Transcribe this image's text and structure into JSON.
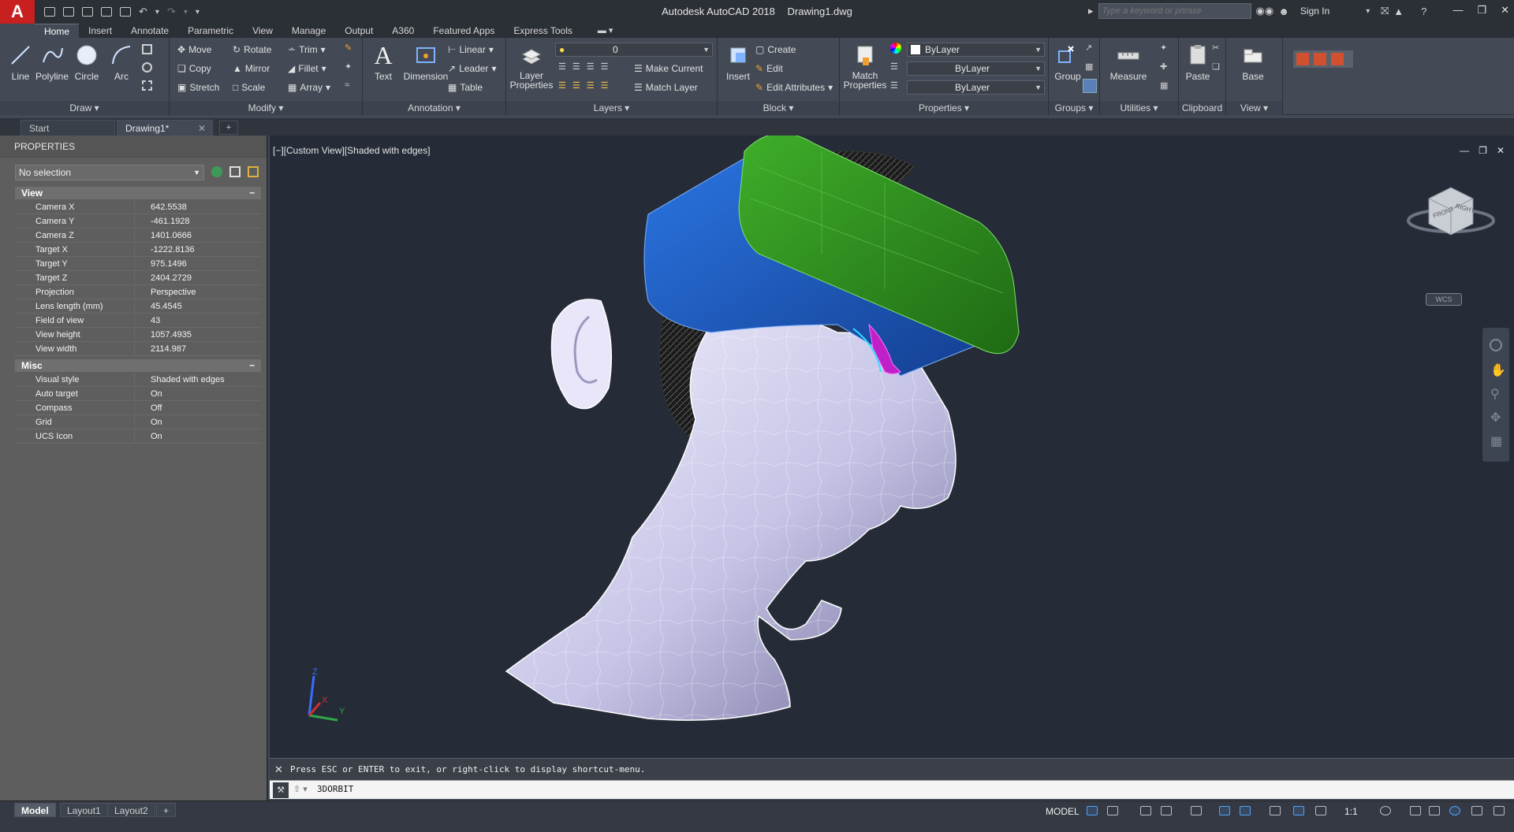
{
  "app": {
    "title": "Autodesk AutoCAD 2018",
    "document": "Drawing1.dwg",
    "app_letter": "A",
    "search_placeholder": "Type a keyword or phrase",
    "signin": "Sign In"
  },
  "ribbon_tabs": [
    "Home",
    "Insert",
    "Annotate",
    "Parametric",
    "View",
    "Manage",
    "Output",
    "A360",
    "Featured Apps",
    "Express Tools"
  ],
  "ribbon": {
    "draw": {
      "title": "Draw",
      "line": "Line",
      "polyline": "Polyline",
      "circle": "Circle",
      "arc": "Arc"
    },
    "modify": {
      "title": "Modify",
      "move": "Move",
      "rotate": "Rotate",
      "trim": "Trim",
      "copy": "Copy",
      "mirror": "Mirror",
      "fillet": "Fillet",
      "stretch": "Stretch",
      "scale": "Scale",
      "array": "Array"
    },
    "annotation": {
      "title": "Annotation",
      "text": "Text",
      "dimension": "Dimension",
      "linear": "Linear",
      "leader": "Leader",
      "table": "Table"
    },
    "layers": {
      "title": "Layers",
      "layer_properties": "Layer Properties",
      "current_layer": "0",
      "make_current": "Make Current",
      "match_layer": "Match Layer"
    },
    "block": {
      "title": "Block",
      "insert": "Insert",
      "create": "Create",
      "edit": "Edit",
      "edit_attributes": "Edit Attributes"
    },
    "properties": {
      "title": "Properties",
      "match_properties": "Match Properties",
      "color": "ByLayer",
      "linetype": "ByLayer",
      "lineweight": "ByLayer"
    },
    "groups": {
      "title": "Groups",
      "group": "Group"
    },
    "utilities": {
      "title": "Utilities",
      "measure": "Measure"
    },
    "clipboard": {
      "title": "Clipboard",
      "paste": "Paste"
    },
    "view": {
      "title": "View",
      "base": "Base"
    }
  },
  "file_tabs": [
    "Start",
    "Drawing1*"
  ],
  "properties_palette": {
    "title": "PROPERTIES",
    "selection": "No selection",
    "view_section": "View",
    "view_rows": [
      {
        "k": "Camera X",
        "v": "642.5538"
      },
      {
        "k": "Camera Y",
        "v": "-461.1928"
      },
      {
        "k": "Camera Z",
        "v": "1401.0666"
      },
      {
        "k": "Target X",
        "v": "-1222.8136"
      },
      {
        "k": "Target Y",
        "v": "975.1496"
      },
      {
        "k": "Target Z",
        "v": "2404.2729"
      },
      {
        "k": "Projection",
        "v": "Perspective"
      },
      {
        "k": "Lens length (mm)",
        "v": "45.4545"
      },
      {
        "k": "Field of view",
        "v": "43"
      },
      {
        "k": "View height",
        "v": "1057.4935"
      },
      {
        "k": "View width",
        "v": "2114.987"
      }
    ],
    "misc_section": "Misc",
    "misc_rows": [
      {
        "k": "Visual style",
        "v": "Shaded with edges"
      },
      {
        "k": "Auto target",
        "v": "On"
      },
      {
        "k": "Compass",
        "v": "Off"
      },
      {
        "k": "Grid",
        "v": "On"
      },
      {
        "k": "UCS Icon",
        "v": "On"
      }
    ]
  },
  "viewport": {
    "label": "[−][Custom View][Shaded with edges]",
    "wcs": "WCS",
    "viewcube_front": "FRONT",
    "viewcube_right": "RIGHT",
    "axis_x": "X",
    "axis_y": "Y",
    "axis_z": "Z"
  },
  "command": {
    "history": "Press ESC or ENTER to exit, or right-click to display shortcut-menu.",
    "current": "3DORBIT"
  },
  "layout_tabs": [
    "Model",
    "Layout1",
    "Layout2"
  ],
  "status": {
    "model": "MODEL",
    "scale": "1:1"
  },
  "colors": {
    "accent": "#c8201e",
    "viewport_bg": "#252c38",
    "headset_green": "#2e8b1f",
    "headset_blue": "#1e5fc4"
  }
}
